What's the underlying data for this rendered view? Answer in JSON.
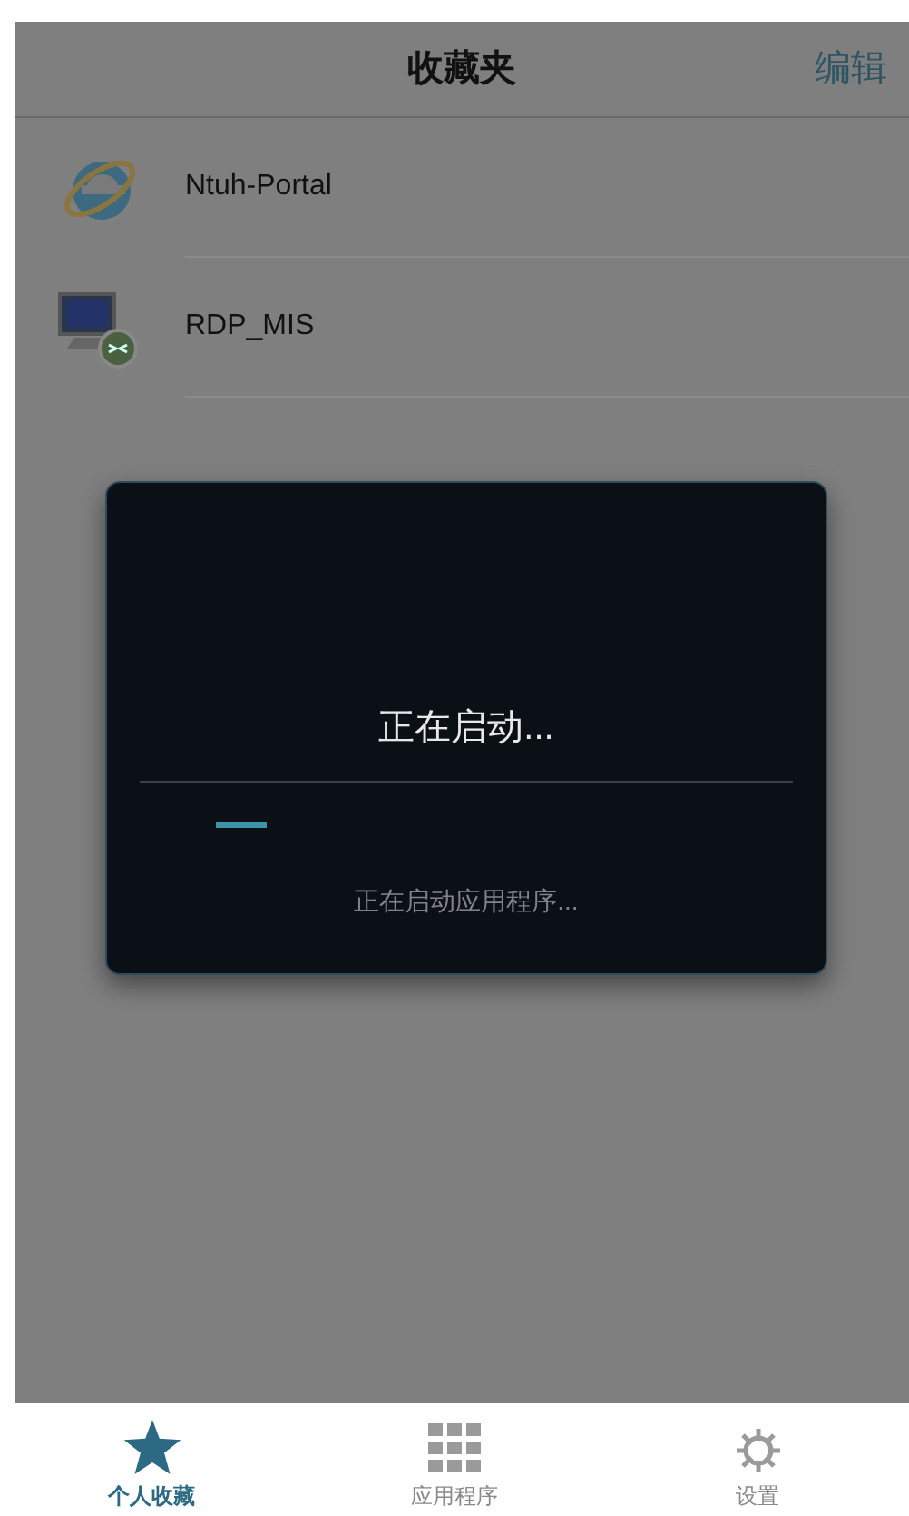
{
  "header": {
    "title": "收藏夹",
    "action": "编辑"
  },
  "favorites": [
    {
      "name": "Ntuh-Portal",
      "kind": "web"
    },
    {
      "name": "RDP_MIS",
      "kind": "remote"
    }
  ],
  "dialog": {
    "title": "正在启动...",
    "message": "正在启动应用程序..."
  },
  "tabs": [
    {
      "label": "个人收藏",
      "kind": "star",
      "selected": true
    },
    {
      "label": "应用程序",
      "kind": "grid",
      "selected": false
    },
    {
      "label": "设置",
      "kind": "gear",
      "selected": false
    }
  ]
}
